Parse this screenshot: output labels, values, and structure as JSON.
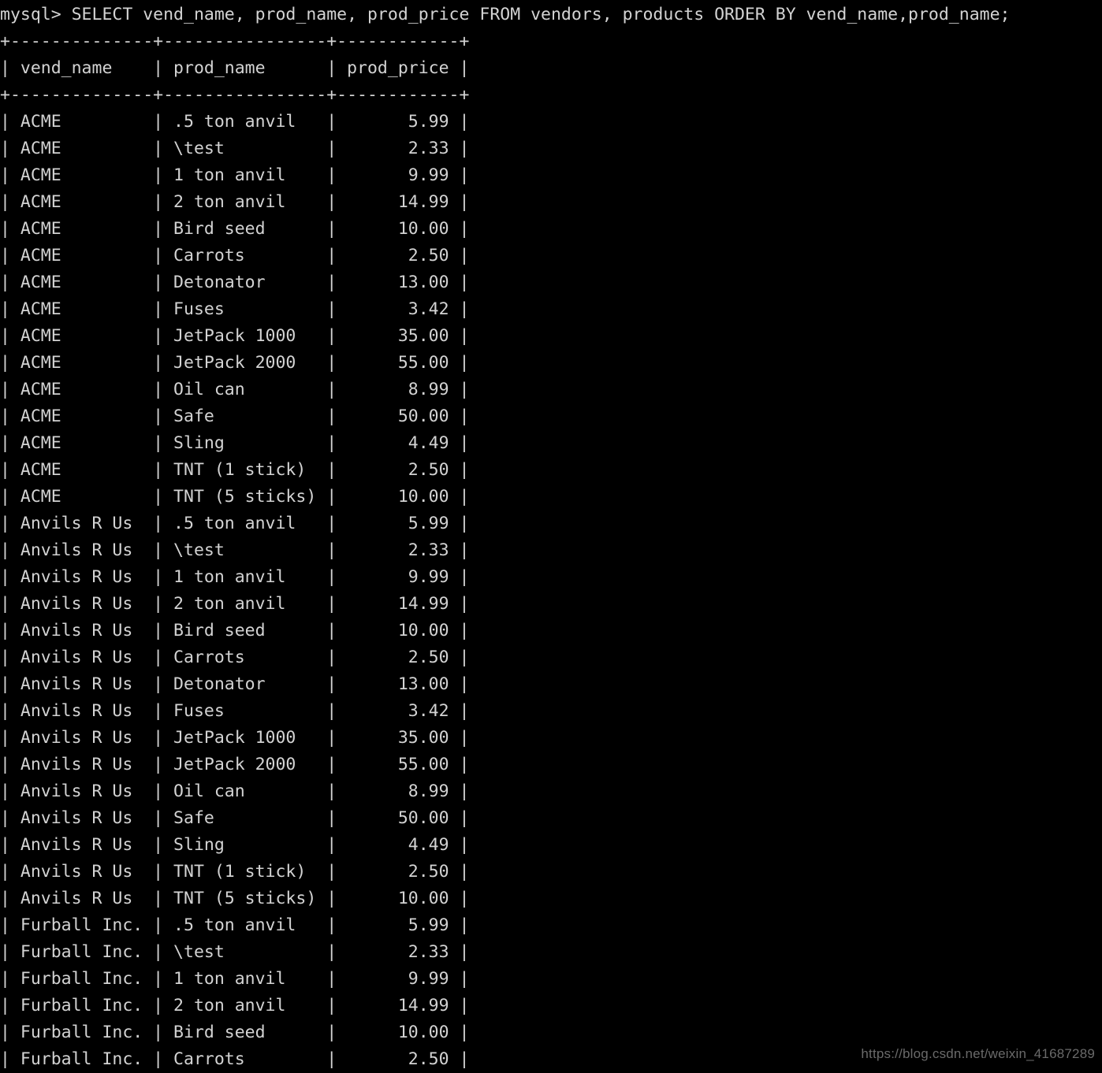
{
  "terminal": {
    "background_color": "#000000",
    "text_color": "#d3d3d3",
    "prompt": "mysql>",
    "query": "SELECT vend_name, prod_name, prod_price FROM vendors, products ORDER BY vend_name,prod_name;",
    "prompt_line": "mysql> SELECT vend_name, prod_name, prod_price FROM vendors, products ORDER BY vend_name,prod_name;"
  },
  "result_table": {
    "border_line": "+--------------+----------------+------------+",
    "columns": [
      {
        "name": "vend_name",
        "width": 14,
        "align": "left"
      },
      {
        "name": "prod_name",
        "width": 16,
        "align": "left"
      },
      {
        "name": "prod_price",
        "width": 12,
        "align": "right"
      }
    ],
    "header_row": "| vend_name    | prod_name      | prod_price |",
    "vendors": [
      "ACME",
      "Anvils R Us",
      "Furball Inc."
    ],
    "products": [
      {
        "prod_name": ".5 ton anvil",
        "prod_price": "5.99"
      },
      {
        "prod_name": "\\test",
        "prod_price": "2.33"
      },
      {
        "prod_name": "1 ton anvil",
        "prod_price": "9.99"
      },
      {
        "prod_name": "2 ton anvil",
        "prod_price": "14.99"
      },
      {
        "prod_name": "Bird seed",
        "prod_price": "10.00"
      },
      {
        "prod_name": "Carrots",
        "prod_price": "2.50"
      },
      {
        "prod_name": "Detonator",
        "prod_price": "13.00"
      },
      {
        "prod_name": "Fuses",
        "prod_price": "3.42"
      },
      {
        "prod_name": "JetPack 1000",
        "prod_price": "35.00"
      },
      {
        "prod_name": "JetPack 2000",
        "prod_price": "55.00"
      },
      {
        "prod_name": "Oil can",
        "prod_price": "8.99"
      },
      {
        "prod_name": "Safe",
        "prod_price": "50.00"
      },
      {
        "prod_name": "Sling",
        "prod_price": "4.49"
      },
      {
        "prod_name": "TNT (1 stick)",
        "prod_price": "2.50"
      },
      {
        "prod_name": "TNT (5 sticks)",
        "prod_price": "10.00"
      }
    ],
    "rows": [
      {
        "vend_name": "ACME",
        "prod_name": ".5 ton anvil",
        "prod_price": "5.99"
      },
      {
        "vend_name": "ACME",
        "prod_name": "\\test",
        "prod_price": "2.33"
      },
      {
        "vend_name": "ACME",
        "prod_name": "1 ton anvil",
        "prod_price": "9.99"
      },
      {
        "vend_name": "ACME",
        "prod_name": "2 ton anvil",
        "prod_price": "14.99"
      },
      {
        "vend_name": "ACME",
        "prod_name": "Bird seed",
        "prod_price": "10.00"
      },
      {
        "vend_name": "ACME",
        "prod_name": "Carrots",
        "prod_price": "2.50"
      },
      {
        "vend_name": "ACME",
        "prod_name": "Detonator",
        "prod_price": "13.00"
      },
      {
        "vend_name": "ACME",
        "prod_name": "Fuses",
        "prod_price": "3.42"
      },
      {
        "vend_name": "ACME",
        "prod_name": "JetPack 1000",
        "prod_price": "35.00"
      },
      {
        "vend_name": "ACME",
        "prod_name": "JetPack 2000",
        "prod_price": "55.00"
      },
      {
        "vend_name": "ACME",
        "prod_name": "Oil can",
        "prod_price": "8.99"
      },
      {
        "vend_name": "ACME",
        "prod_name": "Safe",
        "prod_price": "50.00"
      },
      {
        "vend_name": "ACME",
        "prod_name": "Sling",
        "prod_price": "4.49"
      },
      {
        "vend_name": "ACME",
        "prod_name": "TNT (1 stick)",
        "prod_price": "2.50"
      },
      {
        "vend_name": "ACME",
        "prod_name": "TNT (5 sticks)",
        "prod_price": "10.00"
      },
      {
        "vend_name": "Anvils R Us",
        "prod_name": ".5 ton anvil",
        "prod_price": "5.99"
      },
      {
        "vend_name": "Anvils R Us",
        "prod_name": "\\test",
        "prod_price": "2.33"
      },
      {
        "vend_name": "Anvils R Us",
        "prod_name": "1 ton anvil",
        "prod_price": "9.99"
      },
      {
        "vend_name": "Anvils R Us",
        "prod_name": "2 ton anvil",
        "prod_price": "14.99"
      },
      {
        "vend_name": "Anvils R Us",
        "prod_name": "Bird seed",
        "prod_price": "10.00"
      },
      {
        "vend_name": "Anvils R Us",
        "prod_name": "Carrots",
        "prod_price": "2.50"
      },
      {
        "vend_name": "Anvils R Us",
        "prod_name": "Detonator",
        "prod_price": "13.00"
      },
      {
        "vend_name": "Anvils R Us",
        "prod_name": "Fuses",
        "prod_price": "3.42"
      },
      {
        "vend_name": "Anvils R Us",
        "prod_name": "JetPack 1000",
        "prod_price": "35.00"
      },
      {
        "vend_name": "Anvils R Us",
        "prod_name": "JetPack 2000",
        "prod_price": "55.00"
      },
      {
        "vend_name": "Anvils R Us",
        "prod_name": "Oil can",
        "prod_price": "8.99"
      },
      {
        "vend_name": "Anvils R Us",
        "prod_name": "Safe",
        "prod_price": "50.00"
      },
      {
        "vend_name": "Anvils R Us",
        "prod_name": "Sling",
        "prod_price": "4.49"
      },
      {
        "vend_name": "Anvils R Us",
        "prod_name": "TNT (1 stick)",
        "prod_price": "2.50"
      },
      {
        "vend_name": "Anvils R Us",
        "prod_name": "TNT (5 sticks)",
        "prod_price": "10.00"
      },
      {
        "vend_name": "Furball Inc.",
        "prod_name": ".5 ton anvil",
        "prod_price": "5.99"
      },
      {
        "vend_name": "Furball Inc.",
        "prod_name": "\\test",
        "prod_price": "2.33"
      },
      {
        "vend_name": "Furball Inc.",
        "prod_name": "1 ton anvil",
        "prod_price": "9.99"
      },
      {
        "vend_name": "Furball Inc.",
        "prod_name": "2 ton anvil",
        "prod_price": "14.99"
      },
      {
        "vend_name": "Furball Inc.",
        "prod_name": "Bird seed",
        "prod_price": "10.00"
      },
      {
        "vend_name": "Furball Inc.",
        "prod_name": "Carrots",
        "prod_price": "2.50"
      }
    ]
  },
  "watermark": {
    "text": "https://blog.csdn.net/weixin_41687289",
    "color": "#6a6a6a"
  }
}
